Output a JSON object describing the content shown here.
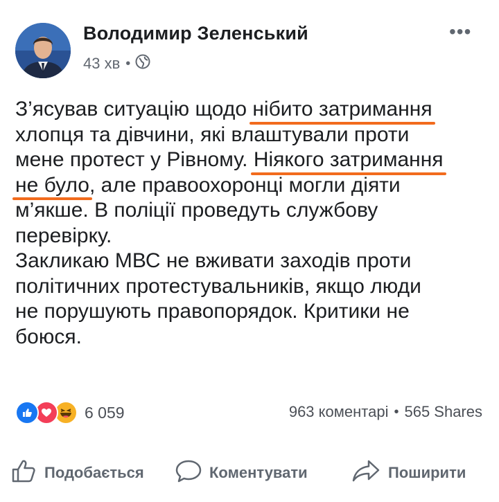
{
  "post": {
    "author": "Володимир Зеленський",
    "time": "43 хв",
    "privacy_icon": "globe-icon",
    "more_icon": "more-horizontal-icon",
    "lines": [
      {
        "a": "З’ясував ситуацію щодо ",
        "u": "нібито затримання",
        "b": ""
      },
      {
        "a": "хлопця та дівчини, які влаштували проти",
        "u": "",
        "b": ""
      },
      {
        "a": "мене протест у Рівному. ",
        "u": "Ніякого затримання",
        "b": ""
      },
      {
        "a": "",
        "u": "не було",
        "b": ", але правоохоронці могли діяти"
      },
      {
        "a": "м’якше. В поліції проведуть службову",
        "u": "",
        "b": ""
      },
      {
        "a": "перевірку.",
        "u": "",
        "b": ""
      },
      {
        "a": "Закликаю МВС не вживати заходів проти",
        "u": "",
        "b": ""
      },
      {
        "a": "політичних протестувальників, якщо люди",
        "u": "",
        "b": ""
      },
      {
        "a": "не порушують правопорядок. Критики не",
        "u": "",
        "b": ""
      },
      {
        "a": "боюся.",
        "u": "",
        "b": ""
      }
    ],
    "highlight_color": "#f26b1d"
  },
  "engagement": {
    "reaction_icons": [
      "like-icon",
      "love-icon",
      "haha-icon"
    ],
    "reaction_count": "6 059",
    "comments": "963 коментарі",
    "shares": "565 Shares"
  },
  "actions": {
    "like_label": "Подобається",
    "comment_label": "Коментувати",
    "share_label": "Поширити"
  },
  "colors": {
    "text": "#1c1e21",
    "secondary": "#616770",
    "like_blue": "#1877f2",
    "love_red": "#f33e58",
    "haha_yellow": "#f7b125"
  }
}
